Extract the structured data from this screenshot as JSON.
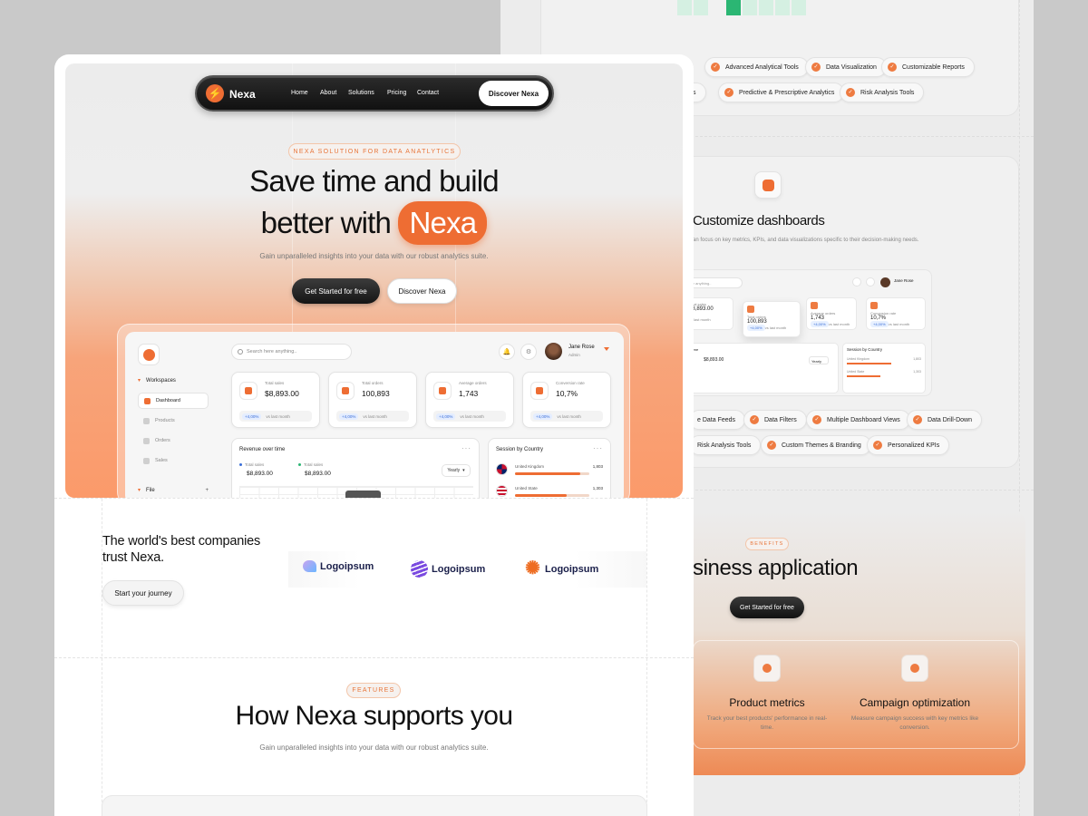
{
  "back": {
    "chips_row1": [
      "Advanced Analytical Tools",
      "Data Visualization",
      "Customizable Reports"
    ],
    "chips_row2_partial": "sis",
    "chips_row2": [
      "Predictive & Prescriptive Analytics",
      "Risk Analysis Tools"
    ],
    "customize_title": "Customize dashboards",
    "customize_sub": "an focus on key metrics, KPIs, and data visualizations specific to their decision-making needs.",
    "mini_dash": {
      "search": "here anything..",
      "user": "Jane Rose",
      "cards": [
        {
          "label": "Total sales",
          "value": "$8,893.00",
          "foot": "vs last month",
          "chip": ""
        },
        {
          "label": "Total orders",
          "value": "100,893",
          "foot": "vs last month",
          "chip": "+4,00%"
        },
        {
          "label": "Average orders",
          "value": "1,743",
          "foot": "vs last month",
          "chip": "+4,00%"
        },
        {
          "label": "Conversion rate",
          "value": "10,7%",
          "foot": "vs last month",
          "chip": "+4,00%"
        }
      ],
      "revenue_title": "er time",
      "revenue_val": "$8,893.00",
      "revenue_val_left": "00",
      "yearly": "Yearly",
      "session_title": "Session by Country",
      "country1": "United Kingdom",
      "country1_val": "1,803",
      "country2": "United State",
      "country2_val": "1,303"
    },
    "chips_row3_partial": "e Data Feeds",
    "chips_row3": [
      "Data Filters",
      "Multiple Dashboard Views",
      "Data Drill-Down"
    ],
    "chips_row4": [
      "Risk Analysis Tools",
      "Custom Themes & Branding",
      "Personalized KPIs"
    ],
    "benefits_label": "BENEFITS",
    "benefits_title": "siness application",
    "benefits_cta": "Get Started for free",
    "benefit1_title": "Product metrics",
    "benefit1_text": "Track your best products' performance in real-time.",
    "benefit2_title": "Campaign optimization",
    "benefit2_text": "Measure campaign success with key metrics like conversion."
  },
  "nav": {
    "brand": "Nexa",
    "links": [
      "Home",
      "About",
      "Solutions",
      "Pricing",
      "Contact"
    ],
    "cta": "Discover Nexa"
  },
  "hero": {
    "label": "NEXA SOLUTION FOR DATA ANATLYTICS",
    "title_line1": "Save time and build",
    "title_line2": "better with",
    "title_highlight": "Nexa",
    "subtitle": "Gain unparalleled insights into your data with our robust analytics suite.",
    "primary_cta": "Get Started for free",
    "secondary_cta": "Discover Nexa"
  },
  "dashboard": {
    "search_placeholder": "Search here anything..",
    "user_name": "Jane Rose",
    "user_role": "Admin",
    "sidebar": {
      "workspaces": "Workspaces",
      "items": [
        "Dashboard",
        "Products",
        "Orders",
        "Sales"
      ],
      "file": "File"
    },
    "stats": [
      {
        "label": "Total sales",
        "value": "$8,893.00",
        "change": "+4,00%",
        "foot": "vs last month"
      },
      {
        "label": "Total orders",
        "value": "100,893",
        "change": "+4,00%",
        "foot": "vs last month"
      },
      {
        "label": "Average orders",
        "value": "1,743",
        "change": "+4,00%",
        "foot": "vs last month"
      },
      {
        "label": "Conversion rate",
        "value": "10,7%",
        "change": "+4,00%",
        "foot": "vs last month"
      }
    ],
    "revenue": {
      "title": "Revenue over time",
      "more": "···",
      "series": [
        {
          "label": "Total sales",
          "value": "$8,893.00",
          "color": "#3b6fd8"
        },
        {
          "label": "Total sales",
          "value": "$8,893.00",
          "color": "#2bb673"
        }
      ],
      "period": "Yearly"
    },
    "session": {
      "title": "Session by Country",
      "more": "···",
      "countries": [
        {
          "name": "United Kingdom",
          "value": "1,803",
          "share": 0.88
        },
        {
          "name": "United State",
          "value": "1,303",
          "share": 0.7
        }
      ]
    }
  },
  "trust": {
    "heading_line1": "The world's best companies",
    "heading_line2": "trust Nexa.",
    "cta": "Start your journey",
    "logos": [
      "Logoipsum",
      "Logoipsum",
      "Logoipsum"
    ]
  },
  "features": {
    "label": "FEATURES",
    "title": "How Nexa supports you",
    "subtitle": "Gain unparalleled insights into your data with our robust analytics suite."
  },
  "colors": {
    "accent": "#ee6d33",
    "dark": "#111111",
    "background": "#c9c9c9"
  }
}
